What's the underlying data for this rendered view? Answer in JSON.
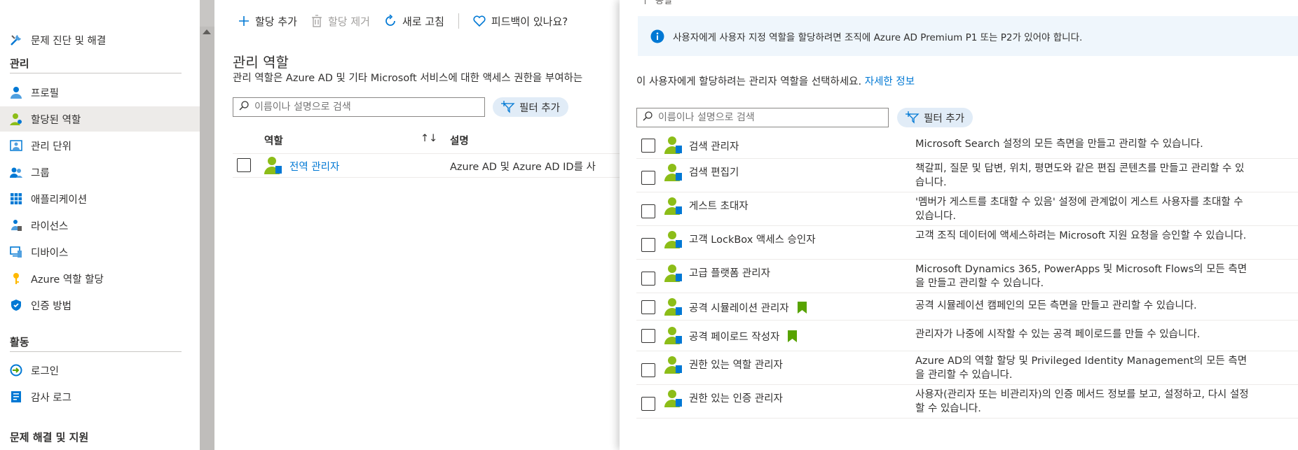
{
  "sidebar": {
    "items": [
      {
        "label": "문제 진단 및 해결",
        "icon": "wrench-icon"
      },
      {
        "label": "프로필",
        "icon": "user-icon"
      },
      {
        "label": "할당된 역할",
        "icon": "user-role-icon"
      },
      {
        "label": "관리 단위",
        "icon": "admin-unit-icon"
      },
      {
        "label": "그룹",
        "icon": "group-icon"
      },
      {
        "label": "애플리케이션",
        "icon": "apps-grid-icon"
      },
      {
        "label": "라이선스",
        "icon": "license-icon"
      },
      {
        "label": "디바이스",
        "icon": "device-icon"
      },
      {
        "label": "Azure 역할 할당",
        "icon": "key-icon"
      },
      {
        "label": "인증 방법",
        "icon": "shield-icon"
      },
      {
        "label": "로그인",
        "icon": "signin-icon"
      },
      {
        "label": "감사 로그",
        "icon": "audit-log-icon"
      }
    ],
    "sections": {
      "manage": "관리",
      "activity": "활동",
      "troubleshoot": "문제 해결 및 지원"
    },
    "collapse_glyph": "«"
  },
  "toolbar": {
    "add": "할당 추가",
    "remove": "할당 제거",
    "refresh": "새로 고침",
    "feedback": "피드백이 있나요?"
  },
  "main": {
    "title": "관리 역할",
    "description": "관리 역할은 Azure AD 및 기타 Microsoft 서비스에 대한 액세스 권한을 부여하는",
    "search_placeholder": "이름이나 설명으로 검색",
    "filter_label": "필터 추가",
    "columns": {
      "role": "역할",
      "description": "설명"
    },
    "sort_glyph": "↑↓",
    "rows": [
      {
        "name": "전역 관리자",
        "description": "Azure AD 및 Azure AD ID를 사"
      }
    ]
  },
  "panel": {
    "top_text": "동일",
    "info_text": "사용자에게 사용자 지정 역할을 할당하려면 조직에 Azure AD Premium P1 또는 P2가 있어야 합니다.",
    "instruction": "이 사용자에게 할당하려는 관리자 역할을 선택하세요.",
    "learn_more": "자세한 정보",
    "search_placeholder": "이름이나 설명으로 검색",
    "filter_label": "필터 추가",
    "roles": [
      {
        "name": "검색 관리자",
        "description": "Microsoft Search 설정의 모든 측면을 만들고 관리할 수 있습니다.",
        "bookmark": false
      },
      {
        "name": "검색 편집기",
        "description": "책갈피, 질문 및 답변, 위치, 평면도와 같은 편집 콘텐츠를 만들고 관리할 수 있습니다.",
        "bookmark": false
      },
      {
        "name": "게스트 초대자",
        "description": "'멤버가 게스트를 초대할 수 있음' 설정에 관계없이 게스트 사용자를 초대할 수 있습니다.",
        "bookmark": false
      },
      {
        "name": "고객 LockBox 액세스 승인자",
        "description": "고객 조직 데이터에 액세스하려는 Microsoft 지원 요청을 승인할 수 있습니다.",
        "bookmark": false
      },
      {
        "name": "고급 플랫폼 관리자",
        "description": "Microsoft Dynamics 365, PowerApps 및 Microsoft Flows의 모든 측면을 만들고 관리할 수 있습니다.",
        "bookmark": false
      },
      {
        "name": "공격 시뮬레이션 관리자",
        "description": "공격 시뮬레이션 캠페인의 모든 측면을 만들고 관리할 수 있습니다.",
        "bookmark": true
      },
      {
        "name": "공격 페이로드 작성자",
        "description": "관리자가 나중에 시작할 수 있는 공격 페이로드를 만들 수 있습니다.",
        "bookmark": true
      },
      {
        "name": "권한 있는 역할 관리자",
        "description": "Azure AD의 역할 할당 및 Privileged Identity Management의 모든 측면을 관리할 수 있습니다.",
        "bookmark": false
      },
      {
        "name": "권한 있는 인증 관리자",
        "description": "사용자(관리자 또는 비관리자)의 인증 메서드 정보를 보고, 설정하고, 다시 설정할 수 있습니다.",
        "bookmark": false
      }
    ]
  },
  "colors": {
    "accent": "#0078d4",
    "bookmark": "#57a300",
    "role_icon_green": "#8cbd18",
    "active_bg": "#edebe9",
    "info_bg": "#eff6fc"
  }
}
